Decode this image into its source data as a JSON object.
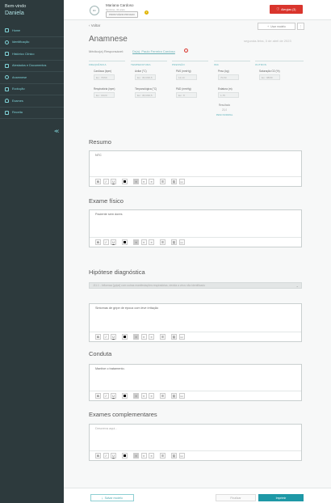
{
  "sidebar": {
    "welcome": "Bem-vindo",
    "user_name": "Daniela",
    "items": [
      {
        "label": "Home",
        "icon": "home-icon"
      },
      {
        "label": "Identificação",
        "icon": "id-icon"
      },
      {
        "label": "Histórico Clínico",
        "icon": "history-icon"
      },
      {
        "label": "Atestados e Documentos",
        "icon": "document-icon"
      },
      {
        "label": "Anamnese",
        "icon": "stethoscope-icon"
      },
      {
        "label": "Evolução",
        "icon": "pen-icon"
      },
      {
        "label": "Exames",
        "icon": "flask-icon"
      },
      {
        "label": "Receita",
        "icon": "prescription-icon"
      }
    ]
  },
  "header": {
    "avatar": "MC",
    "patient_name": "Mariana Cardoso",
    "patient_meta": "feminino, 41 anos",
    "patient_badge": "PRONTUÁRIO PRIVADO",
    "badge_count": "2",
    "allergy_label": "Alergias (3)"
  },
  "page": {
    "back": "Voltar",
    "use_model": "Usar modelo",
    "menu": "⋮",
    "title": "Anamnese",
    "date": "segunda-feira, 3 de abril de 2023",
    "doctor_label": "Médico(a) Responsável:",
    "doctor_name": "Dr(a). Paulo Ferreira Cardoso"
  },
  "vitals": {
    "groups": [
      "FREQUÊNCIA",
      "TEMPERATURA",
      "PRESSÃO",
      "IMC",
      "OUTROS"
    ],
    "fields": [
      {
        "label": "Cardíaca (bpm)",
        "value": "Ex.: 70/69"
      },
      {
        "label": "Respiratória (irpm)",
        "value": "Ex.: 16/20"
      },
      {
        "label": "Axilar (°C)",
        "value": "Ex.: 36,6/36,5"
      },
      {
        "label": "Timpanológica (°C)",
        "value": "Ex.: 36,6/36,5"
      },
      {
        "label": "PAS (mmHg)",
        "value": "12,10"
      },
      {
        "label": "PAD (mmHg)",
        "value": "Ex.: 8"
      },
      {
        "label": "Peso (kg)",
        "value": "70,50"
      },
      {
        "label": "Estatura (m)",
        "value": "1,75"
      },
      {
        "label": "Saturação O2 (%)",
        "value": "Ex.: 98/99"
      }
    ],
    "result_label": "Resultado",
    "result_value": "23,0",
    "result_category": "PESO NORMAL"
  },
  "sections": {
    "resumo": {
      "title": "Resumo",
      "text": "NTC"
    },
    "exame_fisico": {
      "title": "Exame físico",
      "text": "Paciente sem dores"
    },
    "hipotese": {
      "title": "Hipótese diagnóstica",
      "select": "J11.1 - Influenza [gripe] com outras manifestações respiratórias, devida a vírus não identificado",
      "text": "Sintomas de gripe de época com leve irritação"
    },
    "conduta": {
      "title": "Conduta",
      "text": "Mantive o tratamento."
    },
    "exames": {
      "title": "Exames complementares",
      "placeholder": "Descreva aqui..."
    }
  },
  "toolbar": [
    "B",
    "I",
    "U",
    "A",
    "≡",
    "≡",
    "≡",
    "≡",
    "☰",
    "⛓",
    "▭"
  ],
  "footer": {
    "save_model": "Salvar modelo",
    "finish": "Finalizar",
    "print": "Imprimir"
  }
}
